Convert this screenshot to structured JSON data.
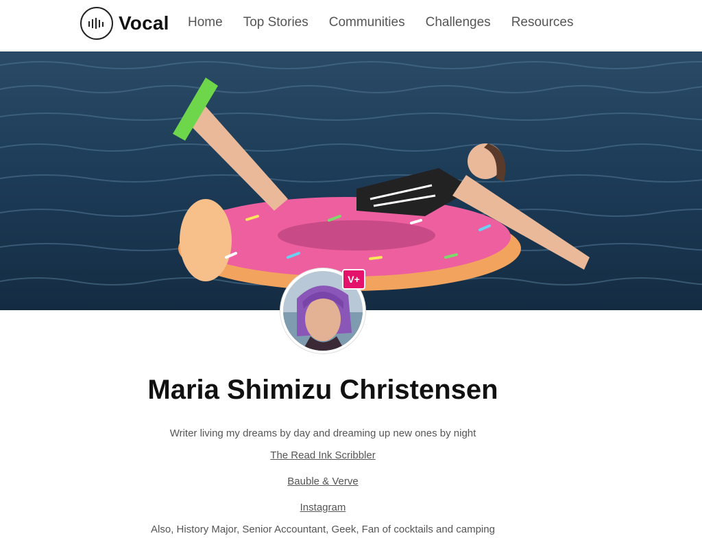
{
  "brand": {
    "name": "Vocal",
    "logo_icon": "sound-bars-icon"
  },
  "nav": {
    "items": [
      "Home",
      "Top Stories",
      "Communities",
      "Challenges",
      "Resources"
    ]
  },
  "hero": {
    "image": "hero-photo"
  },
  "profile": {
    "badge": "V+",
    "badge_color": "#e4126b",
    "name": "Maria Shimizu Christensen",
    "tagline": "Writer living my dreams by day and dreaming up new ones by night",
    "links": [
      "The Read Ink Scribbler",
      "Bauble & Verve",
      "Instagram"
    ],
    "also": "Also, History Major, Senior Accountant, Geek, Fan of cocktails and camping"
  }
}
